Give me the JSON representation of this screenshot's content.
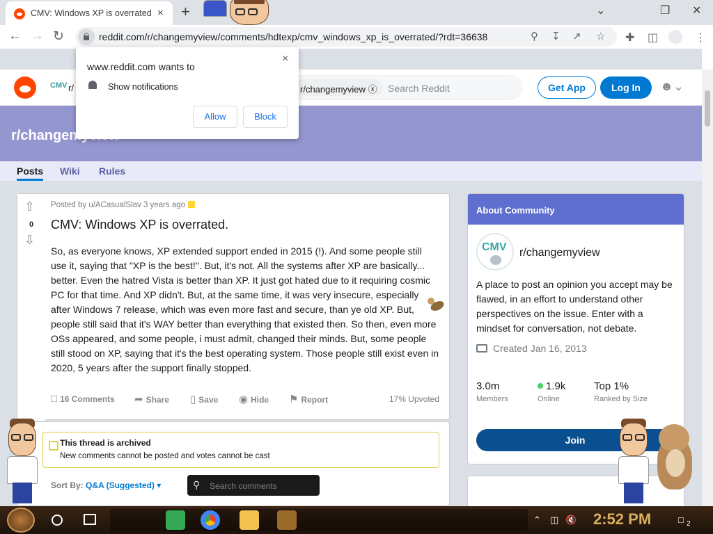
{
  "browser": {
    "tab_title": "CMV: Windows XP is overrated",
    "tab_close": "×",
    "new_tab": "+",
    "url": "reddit.com/r/changemyview/comments/hdtexp/cmv_windows_xp_is_overrated/?rdt=36638",
    "win_minimize": "⌄",
    "win_restore": "❐",
    "win_close": "✕"
  },
  "notification_prompt": {
    "host": "www.reddit.com wants to",
    "message": "Show notifications",
    "allow_label": "Allow",
    "block_label": "Block",
    "close": "×"
  },
  "reddit_header": {
    "sub_short": "r/",
    "search_chip": "r/changemyview",
    "search_chip_clear": "ⓧ",
    "search_placeholder": "Search Reddit",
    "get_app_label": "Get App",
    "login_label": "Log In"
  },
  "subreddit": {
    "banner_title": "r/changemyview",
    "tabs": [
      "Posts",
      "Wiki",
      "Rules"
    ]
  },
  "post": {
    "vote_count": "0",
    "meta": "Posted by u/ACasualSlav 3 years ago",
    "title": "CMV: Windows XP is overrated.",
    "body": "So, as everyone knows, XP extended support ended in 2015 (!). And some people still use it, saying that \"XP is the best!\". But, it's not. All the systems after XP are basically... better. Even the hatred Vista is better than XP. It just got hated due to it requiring cosmic PC for that time. And XP didn't. But, at the same time, it was very insecure, especially after Windows 7 release, which was even more fast and secure, than ye old XP. But, people still said that it's WAY better than everything that existed then. So then, even more OSs appeared, and some people, i must admit, changed their minds. But, some people still stood on XP, saying that it's the best operating system. Those people still exist even in 2020, 5 years after the support finally stopped.",
    "actions": {
      "comments": "16 Comments",
      "share": "Share",
      "save": "Save",
      "hide": "Hide",
      "report": "Report"
    },
    "upvoted": "17% Upvoted"
  },
  "comments": {
    "archived_title": "This thread is archived",
    "archived_sub": "New comments cannot be posted and votes cannot be cast",
    "sort_label": "Sort By:",
    "sort_value": "Q&A (Suggested)",
    "search_placeholder": "Search comments"
  },
  "about": {
    "header": "About Community",
    "logo_text": "CMV",
    "name": "r/changemyview",
    "description": "A place to post an opinion you accept may be flawed, in an effort to understand other perspectives on the issue. Enter with a mindset for conversation, not debate.",
    "created": "Created Jan 16, 2013",
    "stats": [
      {
        "value": "3.0m",
        "label": "Members"
      },
      {
        "value": "1.9k",
        "label": "Online"
      },
      {
        "value": "Top 1%",
        "label": "Ranked by Size"
      }
    ],
    "join_label": "Join"
  },
  "taskbar": {
    "time": "2:52 PM",
    "notification_count": "2"
  },
  "colors": {
    "reddit_orange": "#ff4500",
    "reddit_blue": "#0079d3",
    "banner": "#9496d0",
    "about_header": "#5f6fd0"
  }
}
